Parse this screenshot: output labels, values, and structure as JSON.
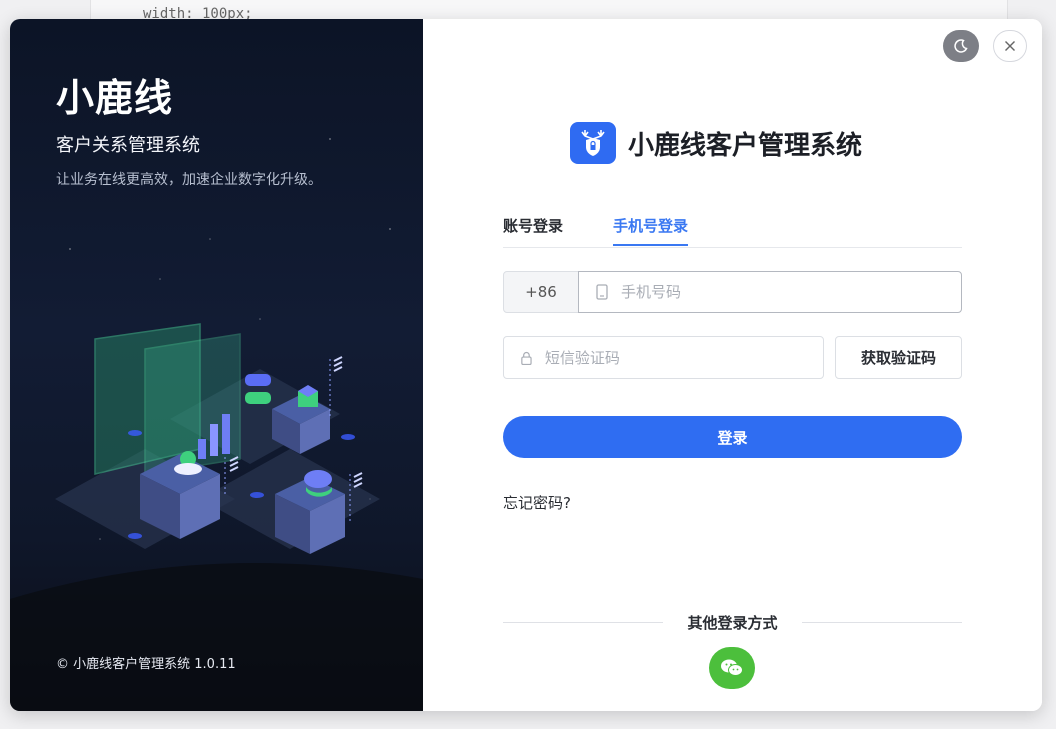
{
  "background": {
    "code_fragment": "width: 100px;"
  },
  "left_panel": {
    "title": "小鹿线",
    "subtitle": "客户关系管理系统",
    "slogan": "让业务在线更高效，加速企业数字化升级。",
    "copyright": "© 小鹿线客户管理系统 1.0.11"
  },
  "header": {
    "app_title": "小鹿线客户管理系统"
  },
  "tabs": [
    {
      "label": "账号登录",
      "active": false
    },
    {
      "label": "手机号登录",
      "active": true
    }
  ],
  "form": {
    "country_code": "+86",
    "phone_placeholder": "手机号码",
    "sms_placeholder": "短信验证码",
    "get_code_label": "获取验证码",
    "login_label": "登录",
    "forgot_label": "忘记密码?"
  },
  "other_login": {
    "label": "其他登录方式",
    "methods": [
      "wechat-icon"
    ]
  },
  "colors": {
    "primary": "#2f6df2",
    "wechat": "#4cbf3c",
    "left_bg": "#0f172a"
  },
  "icons": [
    "moon-icon",
    "close-icon",
    "deer-shield-icon",
    "phone-icon",
    "lock-icon",
    "wechat-icon"
  ]
}
